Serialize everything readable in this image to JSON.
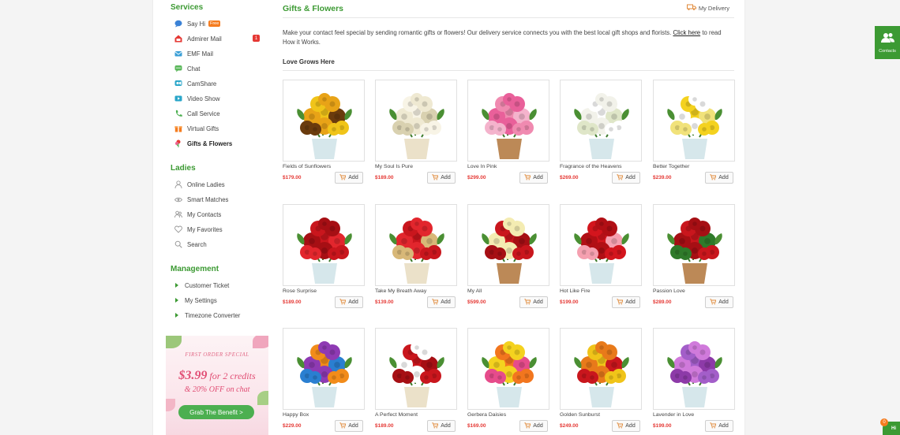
{
  "sidebar": {
    "services_title": "Services",
    "services": [
      {
        "label": "Say Hi",
        "icon": "chat-bubble-icon",
        "badge": "Free"
      },
      {
        "label": "Admirer Mail",
        "icon": "house-mail-icon",
        "count": "1"
      },
      {
        "label": "EMF Mail",
        "icon": "envelope-icon"
      },
      {
        "label": "Chat",
        "icon": "chat-icon"
      },
      {
        "label": "CamShare",
        "icon": "camera-icon"
      },
      {
        "label": "Video Show",
        "icon": "play-icon"
      },
      {
        "label": "Call Service",
        "icon": "phone-icon"
      },
      {
        "label": "Virtual Gifts",
        "icon": "gift-icon"
      },
      {
        "label": "Gifts & Flowers",
        "icon": "flower-icon",
        "active": true
      }
    ],
    "ladies_title": "Ladies",
    "ladies": [
      {
        "label": "Online Ladies",
        "icon": "user-icon"
      },
      {
        "label": "Smart Matches",
        "icon": "match-icon"
      },
      {
        "label": "My Contacts",
        "icon": "contacts-icon"
      },
      {
        "label": "My Favorites",
        "icon": "heart-icon"
      },
      {
        "label": "Search",
        "icon": "search-icon"
      }
    ],
    "management_title": "Management",
    "management": [
      {
        "label": "Customer Ticket"
      },
      {
        "label": "My Settings"
      },
      {
        "label": "Timezone Converter"
      }
    ]
  },
  "promo": {
    "special": "FIRST ORDER SPECIAL",
    "price": "$3.99",
    "price_suffix": "for 2 credits",
    "off": "& 20% OFF on chat",
    "button": "Grab The Benefit >"
  },
  "main": {
    "title": "Gifts & Flowers",
    "delivery_label": "My Delivery",
    "intro_text": "Make your contact feel special by sending romantic gifts or flowers! Our delivery service connects you with the best local gift shops and florists.",
    "intro_link": "Click here",
    "intro_suffix": "to read How it Works.",
    "subtitle": "Love Grows Here",
    "add_label": "Add",
    "products": [
      {
        "name": "Fields of Sunflowers",
        "price": "$179.00",
        "colors": [
          "#f0c419",
          "#e8a317",
          "#6a3b0d"
        ]
      },
      {
        "name": "My Soul Is Pure",
        "price": "$189.00",
        "colors": [
          "#f8f4e6",
          "#efe9d2",
          "#d9d1b0"
        ]
      },
      {
        "name": "Love In Pink",
        "price": "$299.00",
        "colors": [
          "#f08ab0",
          "#e9609a",
          "#f4b3cc"
        ]
      },
      {
        "name": "Fragrance of the Heavens",
        "price": "$269.00",
        "colors": [
          "#ffffff",
          "#f2f2ea",
          "#dfe6c8"
        ]
      },
      {
        "name": "Better Together",
        "price": "$239.00",
        "colors": [
          "#f4d21f",
          "#ffffff",
          "#f1e27a"
        ]
      },
      {
        "name": "Rose Surprise",
        "price": "$189.00",
        "colors": [
          "#c9161d",
          "#a60f14",
          "#e2262d"
        ]
      },
      {
        "name": "Take My Breath Away",
        "price": "$139.00",
        "colors": [
          "#c9161d",
          "#e2262d",
          "#d8b878"
        ]
      },
      {
        "name": "My All",
        "price": "$599.00",
        "colors": [
          "#c9161d",
          "#f4ecb2",
          "#a60f14"
        ]
      },
      {
        "name": "Hot Like Fire",
        "price": "$199.00",
        "colors": [
          "#d3151d",
          "#b10f15",
          "#f5a0b0"
        ]
      },
      {
        "name": "Passion Love",
        "price": "$289.00",
        "colors": [
          "#c9161d",
          "#a60f14",
          "#2f7a2a"
        ]
      },
      {
        "name": "Happy Box",
        "price": "$229.00",
        "colors": [
          "#f28c1a",
          "#8e3ab3",
          "#2a7fd1"
        ]
      },
      {
        "name": "A Perfect Moment",
        "price": "$189.00",
        "colors": [
          "#c9161d",
          "#ffffff",
          "#a60f14"
        ]
      },
      {
        "name": "Gerbera Daisies",
        "price": "$169.00",
        "colors": [
          "#f2761e",
          "#f4d21f",
          "#e64c8b"
        ]
      },
      {
        "name": "Golden Sunburst",
        "price": "$249.00",
        "colors": [
          "#f0c419",
          "#e87a1a",
          "#c9161d"
        ]
      },
      {
        "name": "Lavender in Love",
        "price": "$199.00",
        "colors": [
          "#a35ec9",
          "#d07adb",
          "#8d3aa8"
        ]
      }
    ]
  },
  "floating": {
    "contacts_label": "Contacts",
    "hi_label": "Hi",
    "hi_count": "0"
  },
  "colors": {
    "accent": "#3c9a33",
    "price": "#e53935",
    "badge_free": "#f57c1f"
  }
}
